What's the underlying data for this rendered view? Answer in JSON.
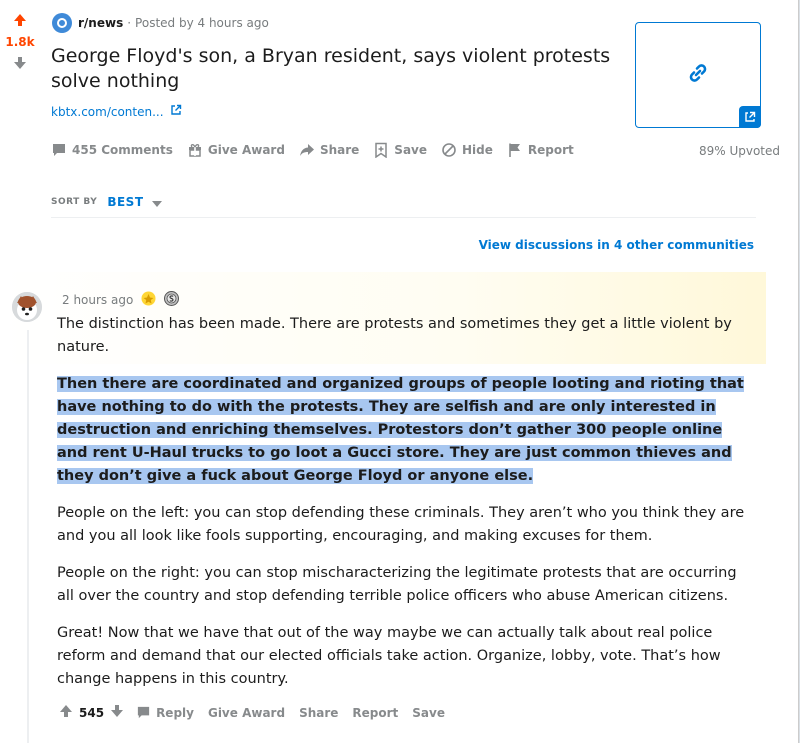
{
  "post": {
    "vote_count": "1.8k",
    "subreddit": "r/news",
    "meta_separator": "·",
    "posted_by": "Posted by 4 hours ago",
    "title": "George Floyd's son, a Bryan resident, says violent protests solve nothing",
    "link_text": "kbtx.com/conten...",
    "actions": {
      "comments": "455 Comments",
      "give_award": "Give Award",
      "share": "Share",
      "save": "Save",
      "hide": "Hide",
      "report": "Report"
    },
    "upvoted": "89% Upvoted"
  },
  "sort": {
    "label": "SORT BY",
    "value": "BEST"
  },
  "other_discussions": "View discussions in 4 other communities",
  "comment": {
    "time": "2 hours ago",
    "paragraphs": [
      "The distinction has been made. There are protests and sometimes they get a little violent by nature.",
      "Then there are coordinated and organized groups of people looting and rioting that have nothing to do with the protests. They are selfish and are only interested in destruction and enriching themselves. Protestors don’t gather 300 people online and rent U-Haul trucks to go loot a Gucci store. They are just common thieves and they don’t give a fuck about George Floyd or anyone else.",
      "People on the left: you can stop defending these criminals. They aren’t who you think they are and you all look like fools supporting, encouraging, and making excuses for them.",
      "People on the right: you can stop mischaracterizing the legitimate protests that are occurring all over the country and stop defending terrible police officers who abuse American citizens.",
      "Great! Now that we have that out of the way maybe we can actually talk about real police reform and demand that our elected officials take action. Organize, lobby, vote. That’s how change happens in this country."
    ],
    "score": "545",
    "actions": {
      "reply": "Reply",
      "give_award": "Give Award",
      "share": "Share",
      "report": "Report",
      "save": "Save"
    }
  },
  "colors": {
    "upvote": "#ff4500",
    "link": "#0079d3",
    "highlight": "#a8c7f0"
  }
}
